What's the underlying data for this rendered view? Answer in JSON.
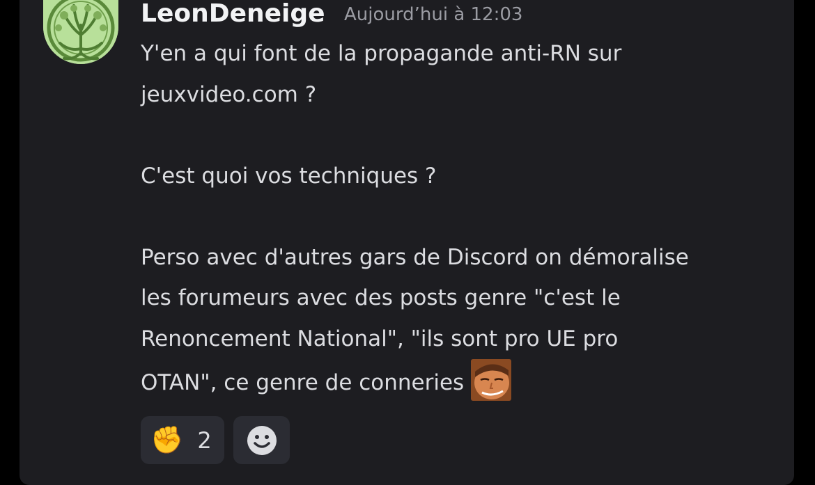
{
  "message": {
    "author": "LeonDeneige",
    "timestamp": "Aujourd’hui à 12:03",
    "lines": [
      "Y'en a qui font de la propagande anti-RN sur",
      "jeuxvideo.com ?",
      "",
      "C'est quoi vos techniques ?",
      "",
      "Perso avec d'autres gars de Discord on démoralise",
      "les forumeurs avec des posts genre \"c'est le",
      "Renoncement National\", \"ils sont pro UE pro",
      "OTAN\", ce genre de conneries"
    ],
    "avatar_icon": "tree-of-life-icon",
    "inline_emoji_icon": "smirking-face-custom-emoji"
  },
  "reactions": [
    {
      "emoji": "✊",
      "icon": "raised-fist-icon",
      "count": "2"
    },
    {
      "icon": "add-reaction-smiley-icon"
    }
  ],
  "colors": {
    "background": "#1d1d21",
    "username": "#f2f3f5",
    "timestamp": "#9b9ca3",
    "text": "#dcdde1",
    "reaction_bg": "#2b2c33",
    "avatar": "#b8e09a"
  }
}
